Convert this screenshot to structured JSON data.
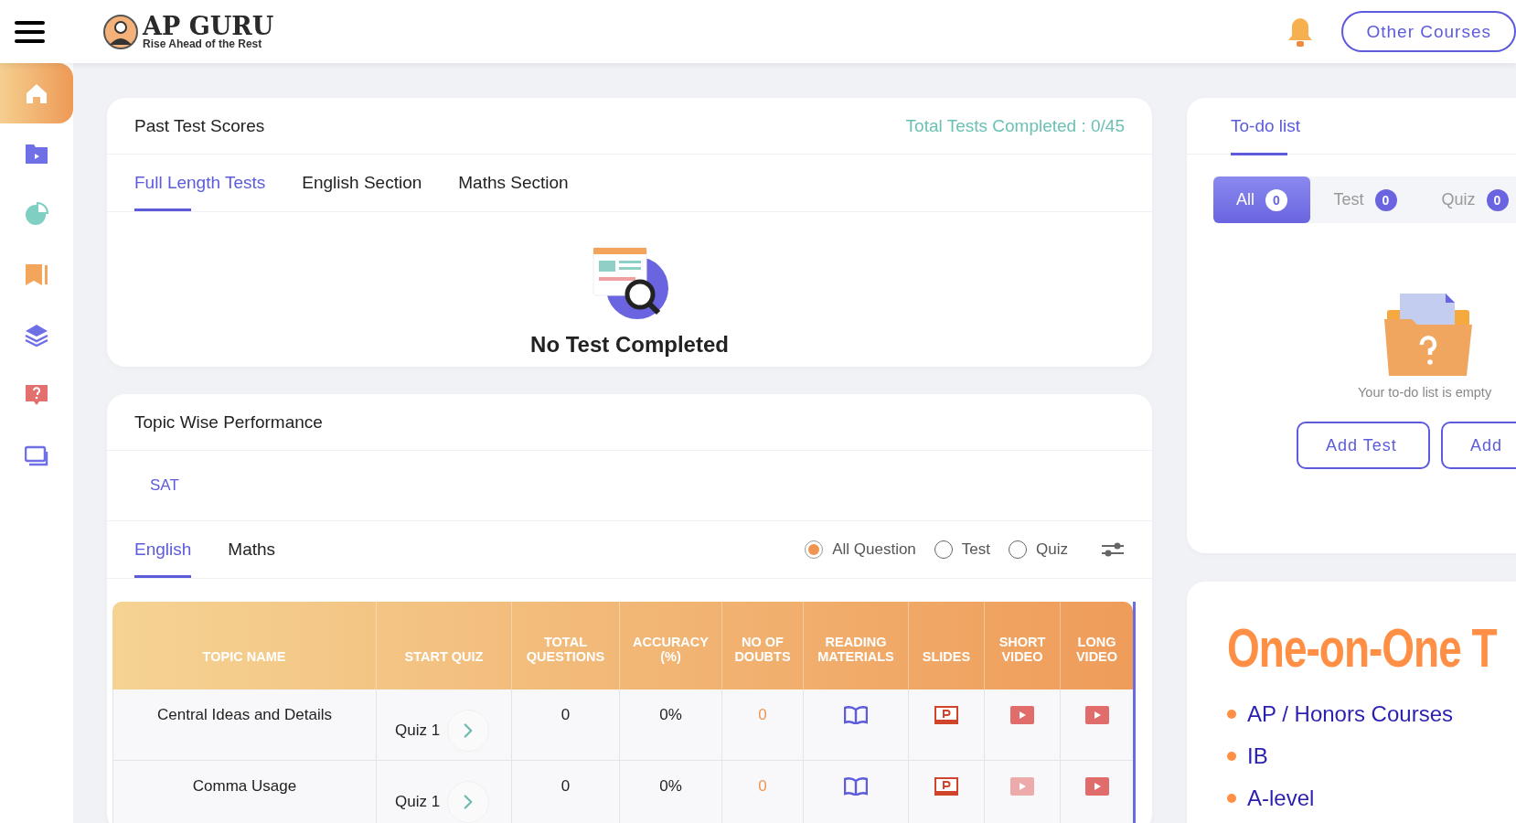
{
  "header": {
    "logo_title": "AP GURU",
    "logo_tagline": "Rise Ahead of the Rest",
    "other_courses_button": "Other Courses"
  },
  "sidebar": {
    "items": [
      {
        "kind": "home",
        "selected": true
      },
      {
        "kind": "videos",
        "selected": false
      },
      {
        "kind": "chart",
        "selected": false
      },
      {
        "kind": "bookmark",
        "selected": false
      },
      {
        "kind": "layers",
        "selected": false
      },
      {
        "kind": "doubts",
        "selected": false
      },
      {
        "kind": "screens",
        "selected": false
      }
    ]
  },
  "past_test_scores": {
    "title": "Past Test Scores",
    "total": "Total Tests Completed : 0/45",
    "tabs": [
      {
        "label": "Full Length Tests",
        "selected": true
      },
      {
        "label": "English Section",
        "selected": false
      },
      {
        "label": "Maths Section",
        "selected": false
      }
    ],
    "empty_message": "No Test Completed"
  },
  "topic_wise_performance": {
    "title": "Topic Wise Performance",
    "exam": "SAT",
    "subject_tabs": [
      {
        "label": "English",
        "selected": true
      },
      {
        "label": "Maths",
        "selected": false
      }
    ],
    "filters": [
      {
        "label": "All Question",
        "selected": true
      },
      {
        "label": "Test",
        "selected": false
      },
      {
        "label": "Quiz",
        "selected": false
      }
    ],
    "table": {
      "columns": [
        "TOPIC NAME",
        "START QUIZ",
        "TOTAL QUESTIONS",
        "ACCURACY (%)",
        "NO OF DOUBTS",
        "READING MATERIALS",
        "SLIDES",
        "SHORT VIDEO",
        "LONG VIDEO"
      ],
      "rows": [
        {
          "topic": "Central Ideas and Details",
          "quiz": "Quiz 1",
          "total_questions": "0",
          "accuracy": "0%",
          "doubts": "0",
          "short_video_disabled": false,
          "long_video_disabled": false
        },
        {
          "topic": "Comma Usage",
          "quiz": "Quiz 1",
          "total_questions": "0",
          "accuracy": "0%",
          "doubts": "0",
          "short_video_disabled": true,
          "long_video_disabled": false
        }
      ]
    }
  },
  "todo": {
    "tab": "To-do list",
    "filters": [
      {
        "label": "All",
        "count": "0",
        "selected": true
      },
      {
        "label": "Test",
        "count": "0",
        "selected": false
      },
      {
        "label": "Quiz",
        "count": "0",
        "selected": false
      }
    ],
    "empty_message": "Your to-do list is empty",
    "buttons": [
      "Add Test",
      "Add"
    ]
  },
  "promo": {
    "heading": "One-on-One T",
    "items": [
      "AP / Honors Courses",
      "IB",
      "A-level"
    ]
  }
}
